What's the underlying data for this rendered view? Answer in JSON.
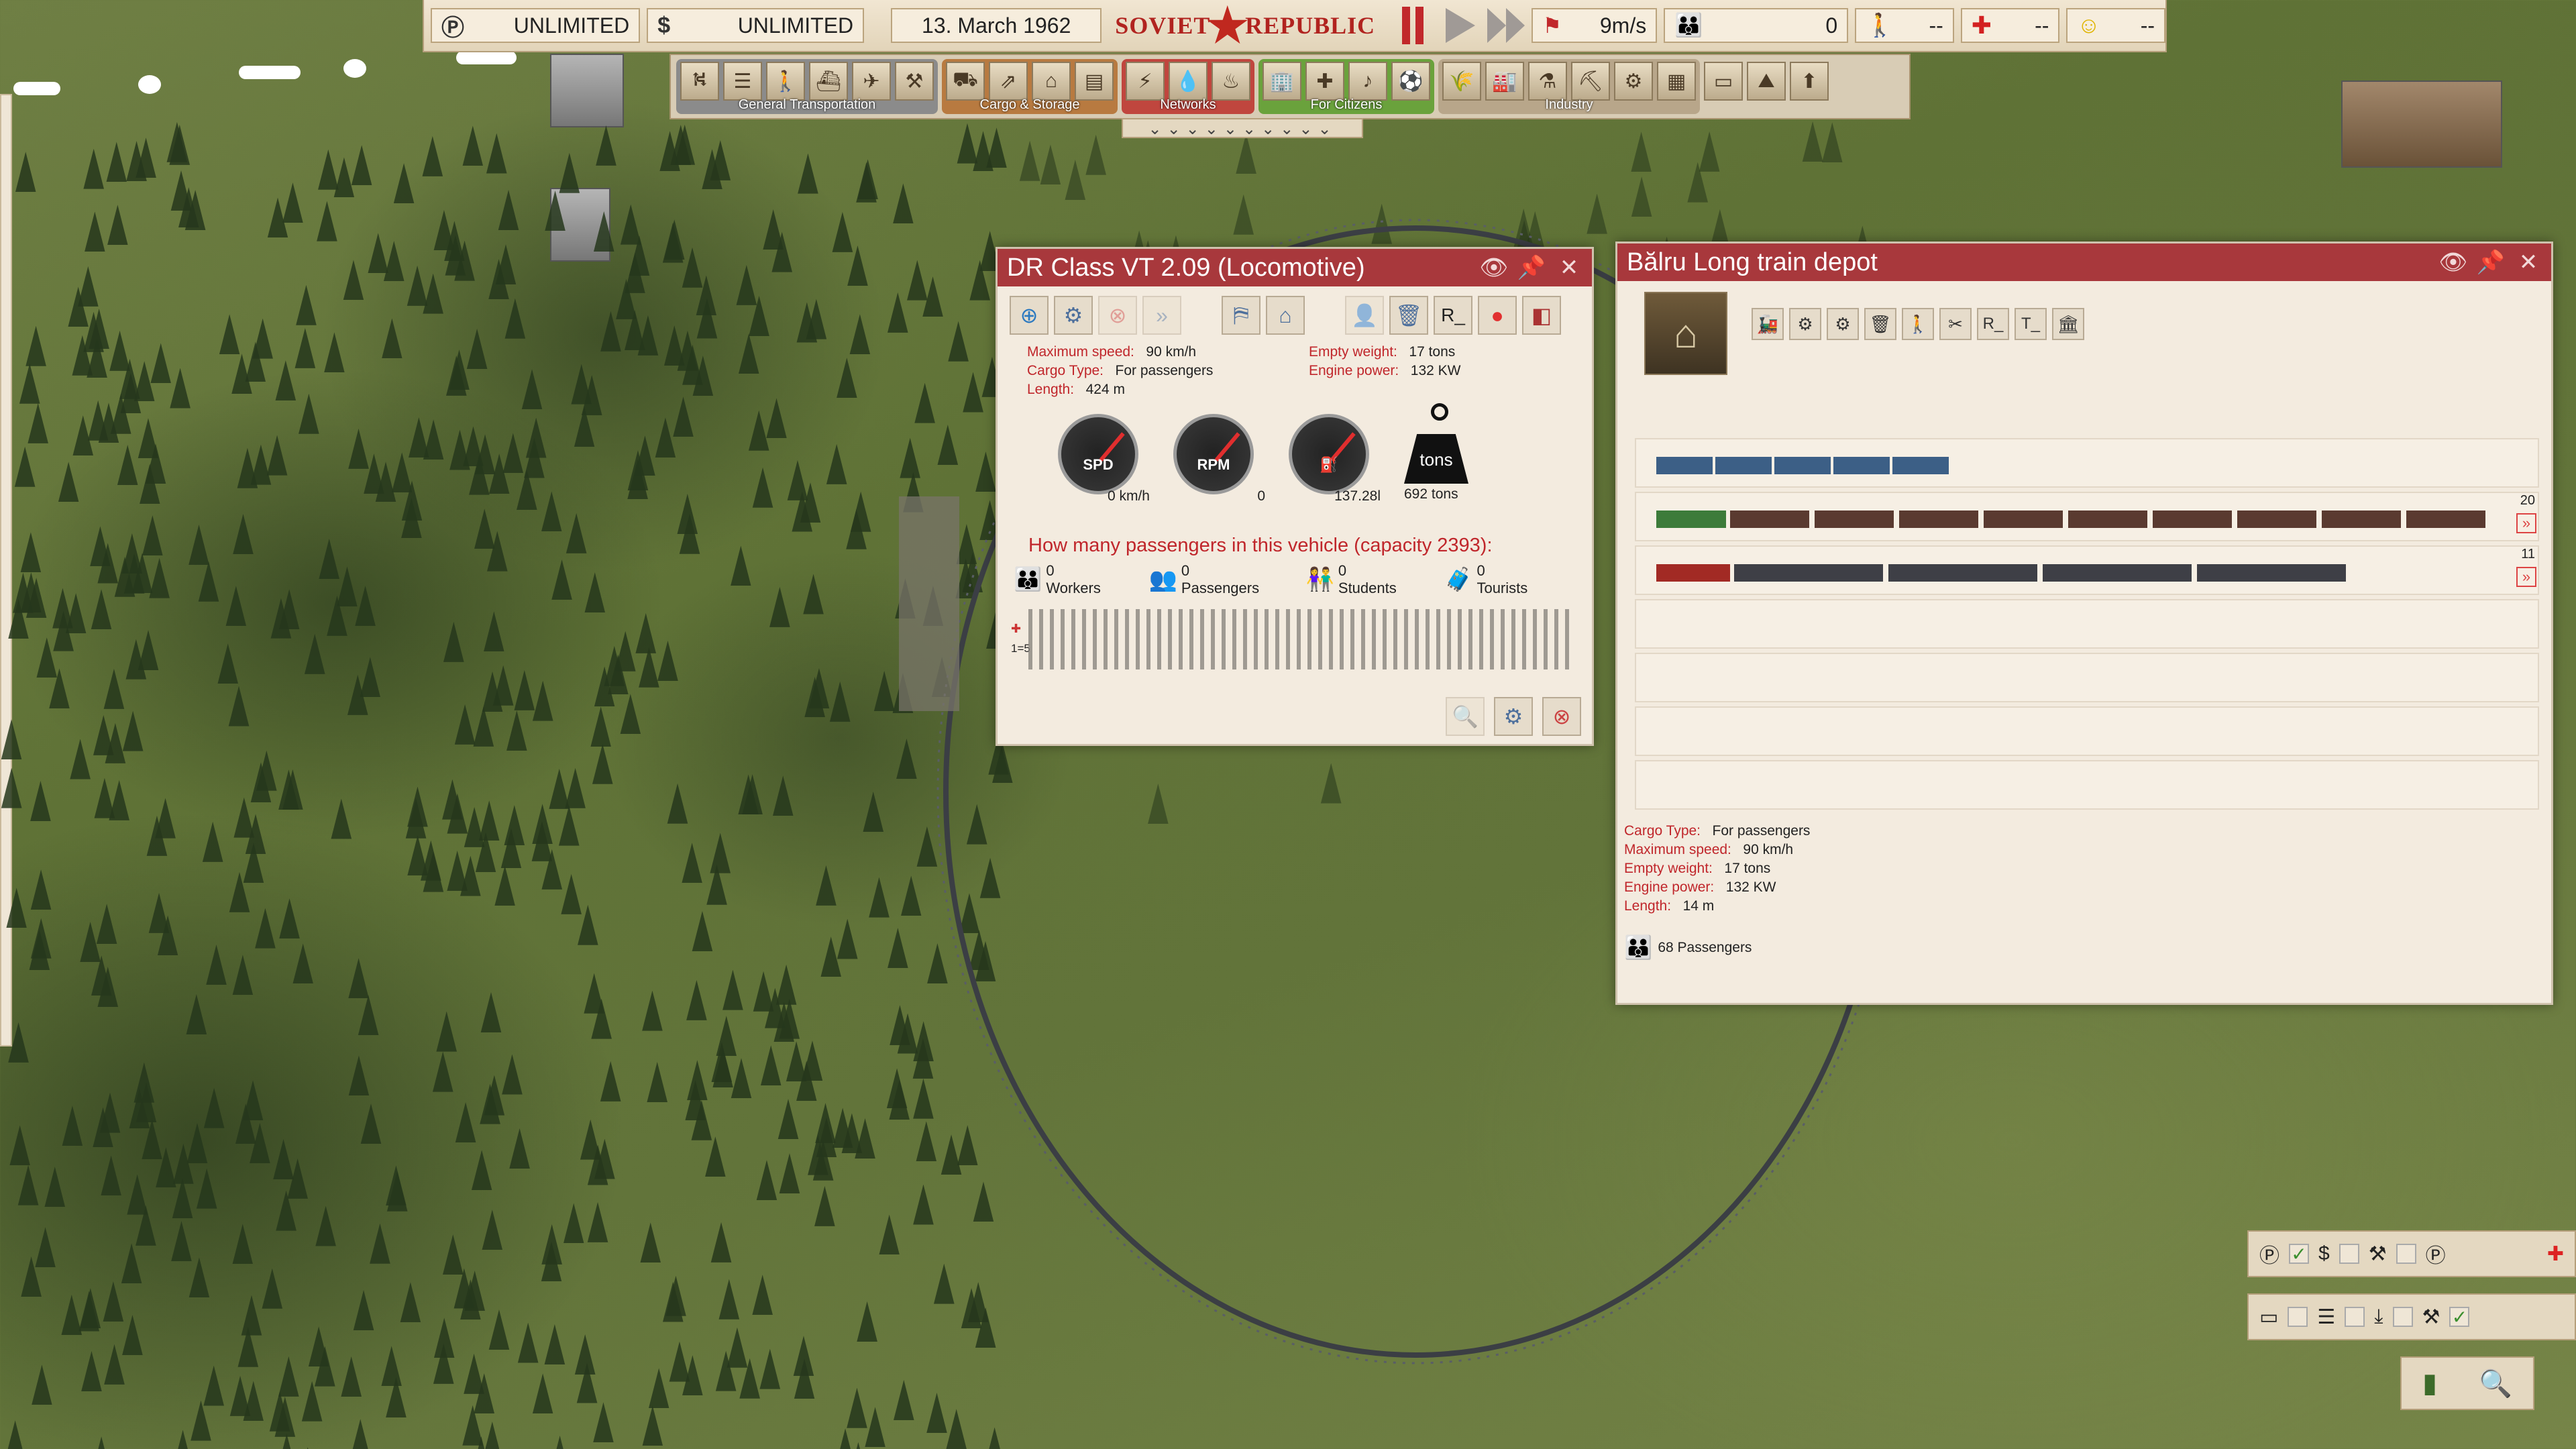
{
  "topbar": {
    "points_value": "UNLIMITED",
    "money_value": "UNLIMITED",
    "date": "13. March 1962",
    "logo_left": "SOVIET",
    "logo_right": "REPUBLIC",
    "wind": "9m/s",
    "population": "0",
    "workers": "--",
    "health": "--",
    "happiness": "--"
  },
  "toolbar": {
    "groups": [
      "General Transportation",
      "Cargo & Storage",
      "Networks",
      "For Citizens",
      "Industry"
    ],
    "chevrons": "⌄⌄⌄⌄⌄⌄⌄⌄⌄⌄"
  },
  "loco": {
    "title": "DR Class VT 2.09 (Locomotive)",
    "stats": {
      "max_speed_k": "Maximum speed:",
      "max_speed_v": "90 km/h",
      "cargo_k": "Cargo Type:",
      "cargo_v": "For passengers",
      "length_k": "Length:",
      "length_v": "424 m",
      "empty_k": "Empty weight:",
      "empty_v": "17 tons",
      "power_k": "Engine power:",
      "power_v": "132 KW"
    },
    "gauges": {
      "spd_label": "SPD",
      "spd_value": "0 km/h",
      "rpm_label": "RPM",
      "rpm_value": "0",
      "fuel_value": "137.28l",
      "weight_label": "tons",
      "weight_value": "692 tons",
      "button_r": "R_"
    },
    "question": "How many passengers in this vehicle (capacity 2393):",
    "occupancy": {
      "workers": "0 Workers",
      "passengers": "0 Passengers",
      "students": "0 Students",
      "tourists": "0 Tourists"
    },
    "scale": "1=5"
  },
  "depot": {
    "title": "Bălru Long train depot",
    "buttons": {
      "r": "R_",
      "t": "T_"
    },
    "rows": [
      {
        "count": ""
      },
      {
        "count": "20"
      },
      {
        "count": "11"
      }
    ],
    "stats": {
      "cargo_k": "Cargo Type:",
      "cargo_v": "For passengers",
      "max_speed_k": "Maximum speed:",
      "max_speed_v": "90 km/h",
      "empty_k": "Empty weight:",
      "empty_v": "17 tons",
      "power_k": "Engine power:",
      "power_v": "132 KW",
      "length_k": "Length:",
      "length_v": "14 m"
    },
    "passengers": "68 Passengers"
  },
  "colors": {
    "title_red": "#a8383c",
    "label_red": "#c0262b",
    "accent_green": "#3a8f2e"
  }
}
